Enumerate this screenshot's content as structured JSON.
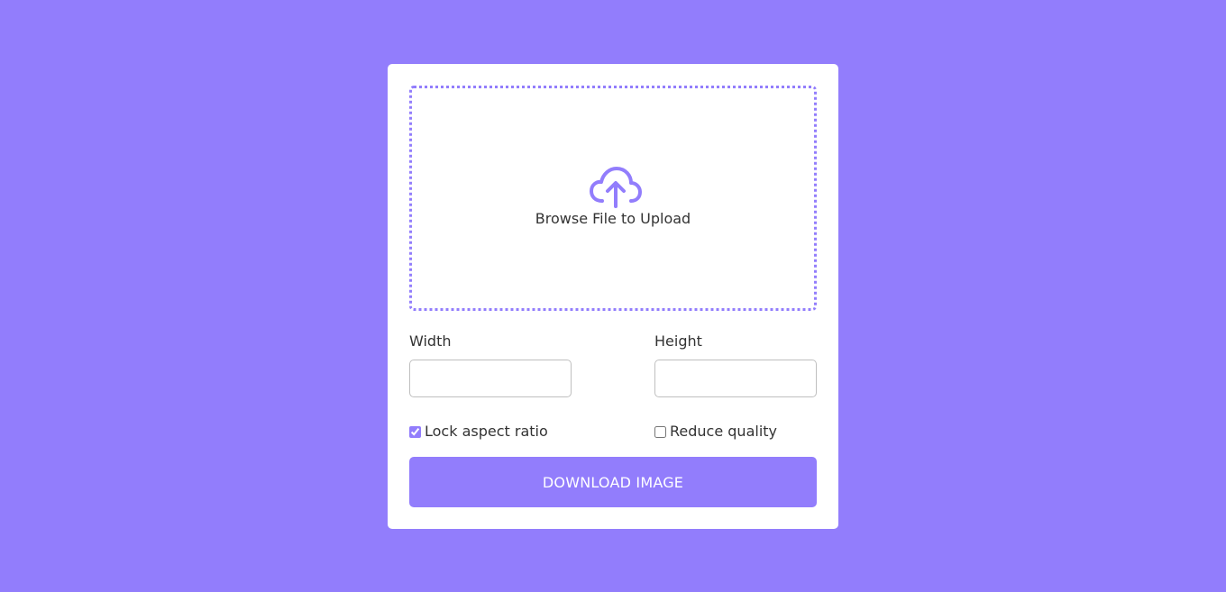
{
  "colors": {
    "background": "#927dfc",
    "accent": "#927dfc",
    "card": "#ffffff",
    "text": "#333333",
    "button_text": "#ffffff"
  },
  "upload": {
    "icon": "cloud-upload-icon",
    "label": "Browse File to Upload"
  },
  "dimensions": {
    "width_label": "Width",
    "width_value": "",
    "height_label": "Height",
    "height_value": ""
  },
  "options": {
    "lock_aspect_label": "Lock aspect ratio",
    "lock_aspect_checked": true,
    "reduce_quality_label": "Reduce quality",
    "reduce_quality_checked": false
  },
  "actions": {
    "download_label": "DOWNLOAD IMAGE"
  }
}
